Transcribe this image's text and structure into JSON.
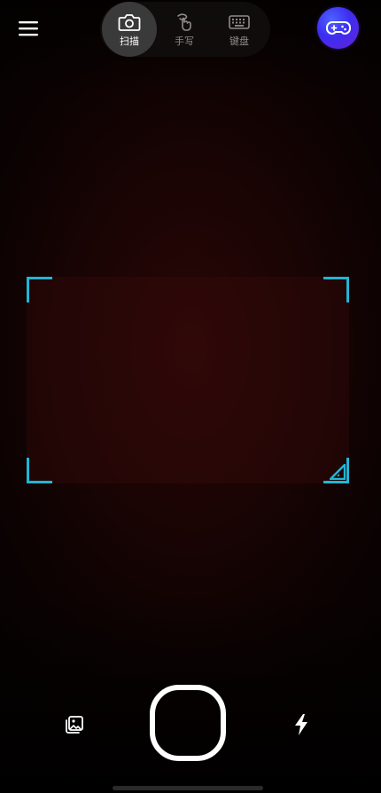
{
  "header": {
    "menu_icon": "hamburger-menu-icon",
    "game_icon": "gamepad-icon",
    "game_button_color": "#3d2ef0"
  },
  "mode_switcher": {
    "tabs": [
      {
        "label": "扫描",
        "icon": "camera-icon",
        "active": true
      },
      {
        "label": "手写",
        "icon": "handwriting-icon",
        "active": false
      },
      {
        "label": "键盘",
        "icon": "keyboard-icon",
        "active": false
      }
    ]
  },
  "scan_frame": {
    "corner_color": "#1fb6d6",
    "resize_icon": "resize-corner-icon"
  },
  "bottom_controls": {
    "gallery_icon": "gallery-image-icon",
    "shutter": "shutter-button",
    "flash_icon": "flash-icon"
  }
}
